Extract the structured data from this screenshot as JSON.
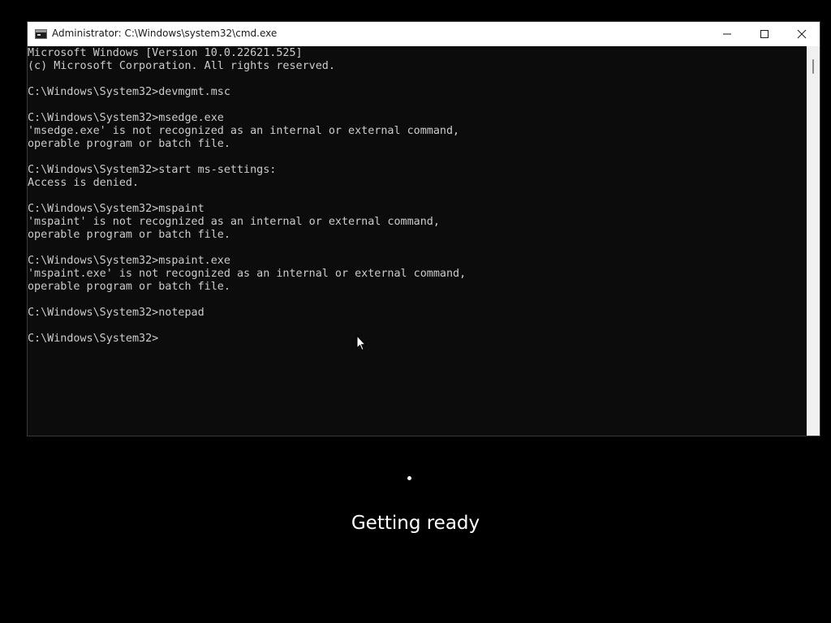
{
  "window": {
    "title": "Administrator: C:\\Windows\\system32\\cmd.exe",
    "icon": "cmd-icon",
    "controls": {
      "minimize": "minimize-icon",
      "maximize": "maximize-icon",
      "close": "close-icon"
    }
  },
  "console": {
    "lines": [
      "Microsoft Windows [Version 10.0.22621.525]",
      "(c) Microsoft Corporation. All rights reserved.",
      "",
      "C:\\Windows\\System32>devmgmt.msc",
      "",
      "C:\\Windows\\System32>msedge.exe",
      "'msedge.exe' is not recognized as an internal or external command,",
      "operable program or batch file.",
      "",
      "C:\\Windows\\System32>start ms-settings:",
      "Access is denied.",
      "",
      "C:\\Windows\\System32>mspaint",
      "'mspaint' is not recognized as an internal or external command,",
      "operable program or batch file.",
      "",
      "C:\\Windows\\System32>mspaint.exe",
      "'mspaint.exe' is not recognized as an internal or external command,",
      "operable program or batch file.",
      "",
      "C:\\Windows\\System32>notepad",
      "",
      "C:\\Windows\\System32>"
    ]
  },
  "overlay": {
    "status": "Getting ready"
  },
  "colors": {
    "background": "#000000",
    "console_bg": "#0c0c0c",
    "console_fg": "#cccccc",
    "titlebar": "#ffffff"
  }
}
